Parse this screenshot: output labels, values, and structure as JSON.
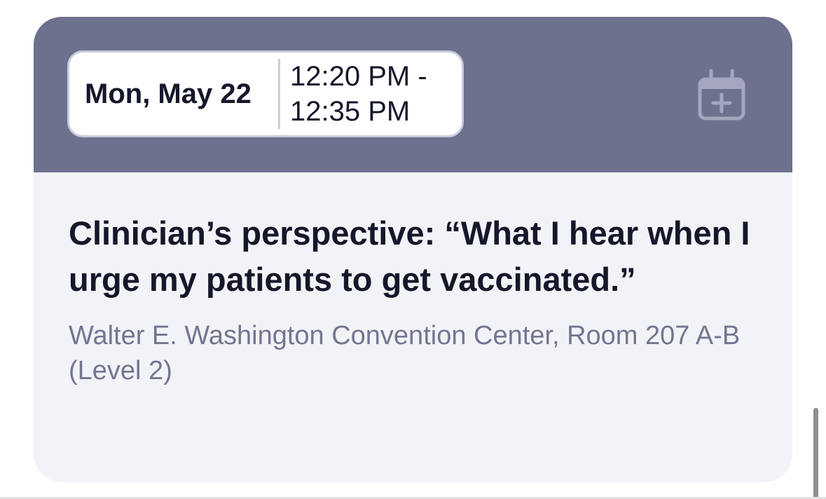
{
  "session": {
    "date": "Mon, May 22",
    "time_start": "12:20 PM -",
    "time_end": "12:35 PM",
    "title": "Clinician’s perspective: “What I hear when I urge my patients to get vaccinated.”",
    "location": "Walter E. Washington Convention Center, Room 207 A-B (Level 2)"
  },
  "icons": {
    "add_to_calendar": "calendar-add-icon"
  },
  "colors": {
    "header_bg": "#6d718e",
    "card_bg": "#f2f3f7",
    "title_text": "#15172a",
    "location_text": "#737691",
    "pill_border": "#c9cae0",
    "calendar_icon": "#a5a7c0"
  }
}
